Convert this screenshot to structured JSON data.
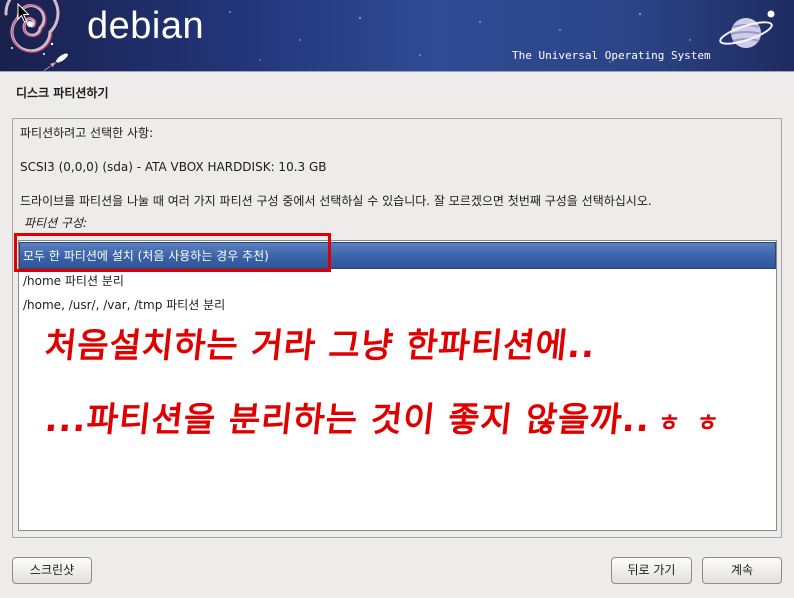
{
  "header": {
    "logo_text": "debian",
    "tagline": "The Universal Operating System"
  },
  "icons": {
    "logo_swirl": "debian-swirl-icon",
    "rocket": "rocket-icon",
    "planet": "planet-icon",
    "cursor": "mouse-cursor-icon"
  },
  "page": {
    "title": "디스크 파티션하기"
  },
  "main": {
    "selected_label": "파티션하려고 선택한 사항:",
    "disk_info": "SCSI3 (0,0,0) (sda) - ATA VBOX HARDDISK: 10.3 GB",
    "description": "드라이브를 파티션을 나눌 때 여러 가지 파티션 구성 중에서 선택하실 수 있습니다. 잘 모르겠으면 첫번째 구성을 선택하십시오.",
    "list_label": "파티션 구성:",
    "options": [
      {
        "label": "모두 한 파티션에 설치 (처음 사용하는 경우 추천)",
        "selected": true
      },
      {
        "label": "/home 파티션 분리",
        "selected": false
      },
      {
        "label": "/home, /usr/, /var, /tmp 파티션 분리",
        "selected": false
      }
    ]
  },
  "annotation": {
    "line1": "처음설치하는 거라 그냥 한파티션에..",
    "line2": "...파티션을 분리하는 것이 좋지 않을까..",
    "line2_suffix": "ㅎ ㅎ"
  },
  "buttons": {
    "screenshot": "스크린샷",
    "back": "뒤로 가기",
    "continue": "계속"
  },
  "theme": {
    "header_bg": "#23357a",
    "selection_bg": "#3a62a6",
    "annotation_color": "#e00000"
  }
}
